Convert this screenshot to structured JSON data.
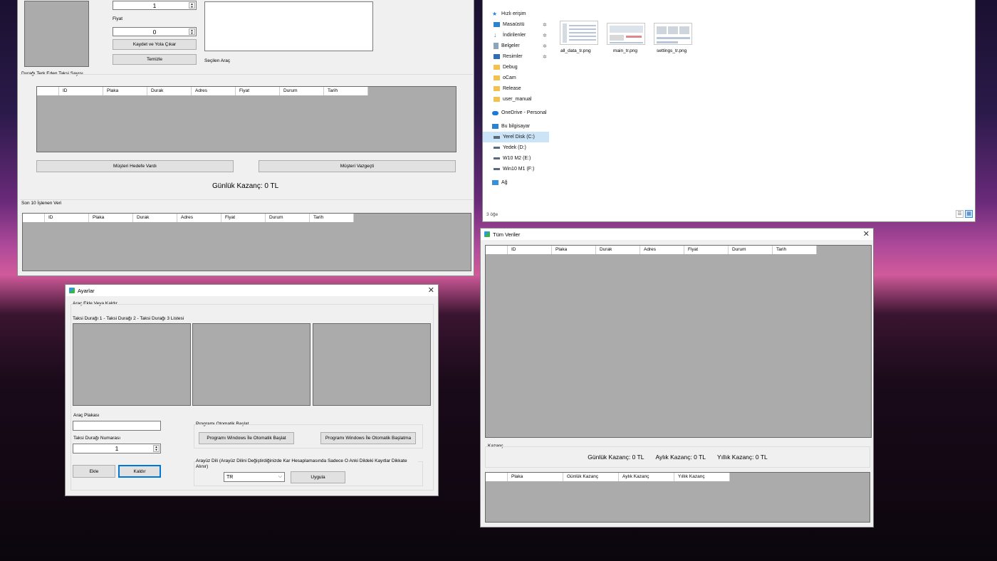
{
  "main_window": {
    "qty_value": "1",
    "price_label": "Fiyat",
    "price_value": "0",
    "save_button": "Kaydet ve Yola Çıkar",
    "clear_button": "Temizle",
    "selected_vehicle_label": "Seçilen Araç",
    "departed_group": "Durağı Terk Eden Taksi Sayısı",
    "columns": [
      "ID",
      "Plaka",
      "Durak",
      "Adres",
      "Fiyat",
      "Durum",
      "Tarih"
    ],
    "reached_button": "Müşteri Hedefe Vardı",
    "gave_up_button": "Müşteri Vazgeçti",
    "daily_earnings": "Günlük Kazanç: 0 TL",
    "last10_group": "Son 10 İşlenen Veri"
  },
  "explorer": {
    "sidebar": [
      {
        "label": "Hızlı erişim",
        "icon": "star-icon",
        "pin": false
      },
      {
        "label": "Masaüstü",
        "icon": "desktop-icon",
        "pin": true
      },
      {
        "label": "İndirilenler",
        "icon": "download-icon",
        "pin": true
      },
      {
        "label": "Belgeler",
        "icon": "document-icon",
        "pin": true
      },
      {
        "label": "Resimler",
        "icon": "pictures-icon",
        "pin": true
      },
      {
        "label": "Debug",
        "icon": "folder-icon",
        "pin": false
      },
      {
        "label": "oCam",
        "icon": "folder-icon",
        "pin": false
      },
      {
        "label": "Release",
        "icon": "folder-icon",
        "pin": false
      },
      {
        "label": "user_manual",
        "icon": "folder-icon",
        "pin": false
      },
      {
        "label": "OneDrive - Personal",
        "icon": "cloud-icon",
        "pin": false
      },
      {
        "label": "Bu bilgisayar",
        "icon": "computer-icon",
        "pin": false
      },
      {
        "label": "Yerel Disk (C:)",
        "icon": "drive-icon",
        "pin": false
      },
      {
        "label": "Yedek (D:)",
        "icon": "drive-icon",
        "pin": false
      },
      {
        "label": "W10 M2 (E:)",
        "icon": "drive-icon",
        "pin": false
      },
      {
        "label": "Win10 M1 (F:)",
        "icon": "drive-icon",
        "pin": false
      },
      {
        "label": "Ağ",
        "icon": "network-icon",
        "pin": false
      }
    ],
    "files": [
      "all_data_tr.png",
      "main_tr.png",
      "settings_tr.png"
    ],
    "status": "3 öğe"
  },
  "all_data": {
    "title": "Tüm Veriler",
    "columns": [
      "ID",
      "Plaka",
      "Durak",
      "Adres",
      "Fiyat",
      "Durum",
      "Tarih"
    ],
    "earnings_group": "Kazanç",
    "daily": "Günlük Kazanç: 0 TL",
    "monthly": "Aylık Kazanç: 0 TL",
    "yearly": "Yıllık Kazanç: 0 TL",
    "earn_columns": [
      "Plaka",
      "Günlük Kazanç",
      "Aylık Kazanç",
      "Yıllık Kazanç"
    ]
  },
  "settings": {
    "title": "Ayarlar",
    "group_title": "Araç Ekle Veya Kaldır",
    "lists_label": "Taksi Durağı 1 - Taksi Durağı 2 - Taksi Durağı 3 Listesi",
    "plate_label": "Araç Plakası",
    "stop_number_label": "Taksi Durağı Numarası",
    "stop_number_value": "1",
    "add_button": "Ekle",
    "remove_button": "Kaldır",
    "autostart_group": "Programı Otomatik Başlat",
    "autostart_on": "Programı Windows İle Otomatik Başlat",
    "autostart_off": "Programı Windows İle Otomatik Başlatma",
    "language_group": "Arayüz Dili (Arayüz Dilini Değiştirdiğinizde Kar Hesaplamasında Sadece O Anki Dildeki Kayıtlar Dikkate Alınır)",
    "language_value": "TR",
    "apply_button": "Uygula"
  }
}
